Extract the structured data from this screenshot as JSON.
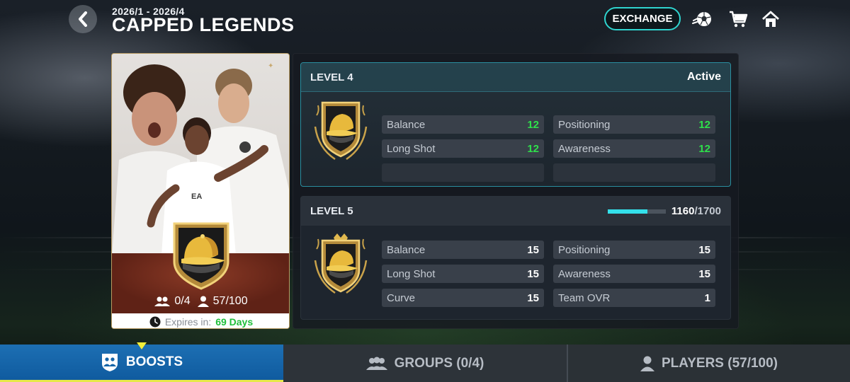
{
  "header": {
    "period": "2026/1 - 2026/4",
    "title": "CAPPED LEGENDS",
    "exchange_label": "EXCHANGE",
    "icons": [
      "back-arrow-icon",
      "football-icon",
      "cart-icon",
      "home-icon"
    ]
  },
  "card": {
    "groups_count": "0/4",
    "players_count": "57/100",
    "expires_label": "Expires in:",
    "expires_value": "69 Days"
  },
  "levels": [
    {
      "label": "LEVEL 4",
      "status": "Active",
      "stats": [
        {
          "name": "Balance",
          "value": "12"
        },
        {
          "name": "Positioning",
          "value": "12"
        },
        {
          "name": "Long Shot",
          "value": "12"
        },
        {
          "name": "Awareness",
          "value": "12"
        }
      ]
    },
    {
      "label": "LEVEL 5",
      "progress_current": "1160",
      "progress_max": "/1700",
      "progress_fraction": 0.68,
      "stats": [
        {
          "name": "Balance",
          "value": "15"
        },
        {
          "name": "Positioning",
          "value": "15"
        },
        {
          "name": "Long Shot",
          "value": "15"
        },
        {
          "name": "Awareness",
          "value": "15"
        },
        {
          "name": "Curve",
          "value": "15"
        },
        {
          "name": "Team OVR",
          "value": "1"
        }
      ]
    }
  ],
  "tabs": [
    {
      "label": "BOOSTS",
      "selected": true
    },
    {
      "label": "GROUPS (0/4)",
      "selected": false
    },
    {
      "label": "PLAYERS (57/100)",
      "selected": false
    }
  ],
  "colors": {
    "accent": "#2fd4cf",
    "stat_green": "#2ee04a",
    "progress_fill": "#34e0ea",
    "tab_selected": "#1565a8",
    "tab_marker": "#f2ee3a",
    "expiry_green": "#1fbf3a"
  }
}
